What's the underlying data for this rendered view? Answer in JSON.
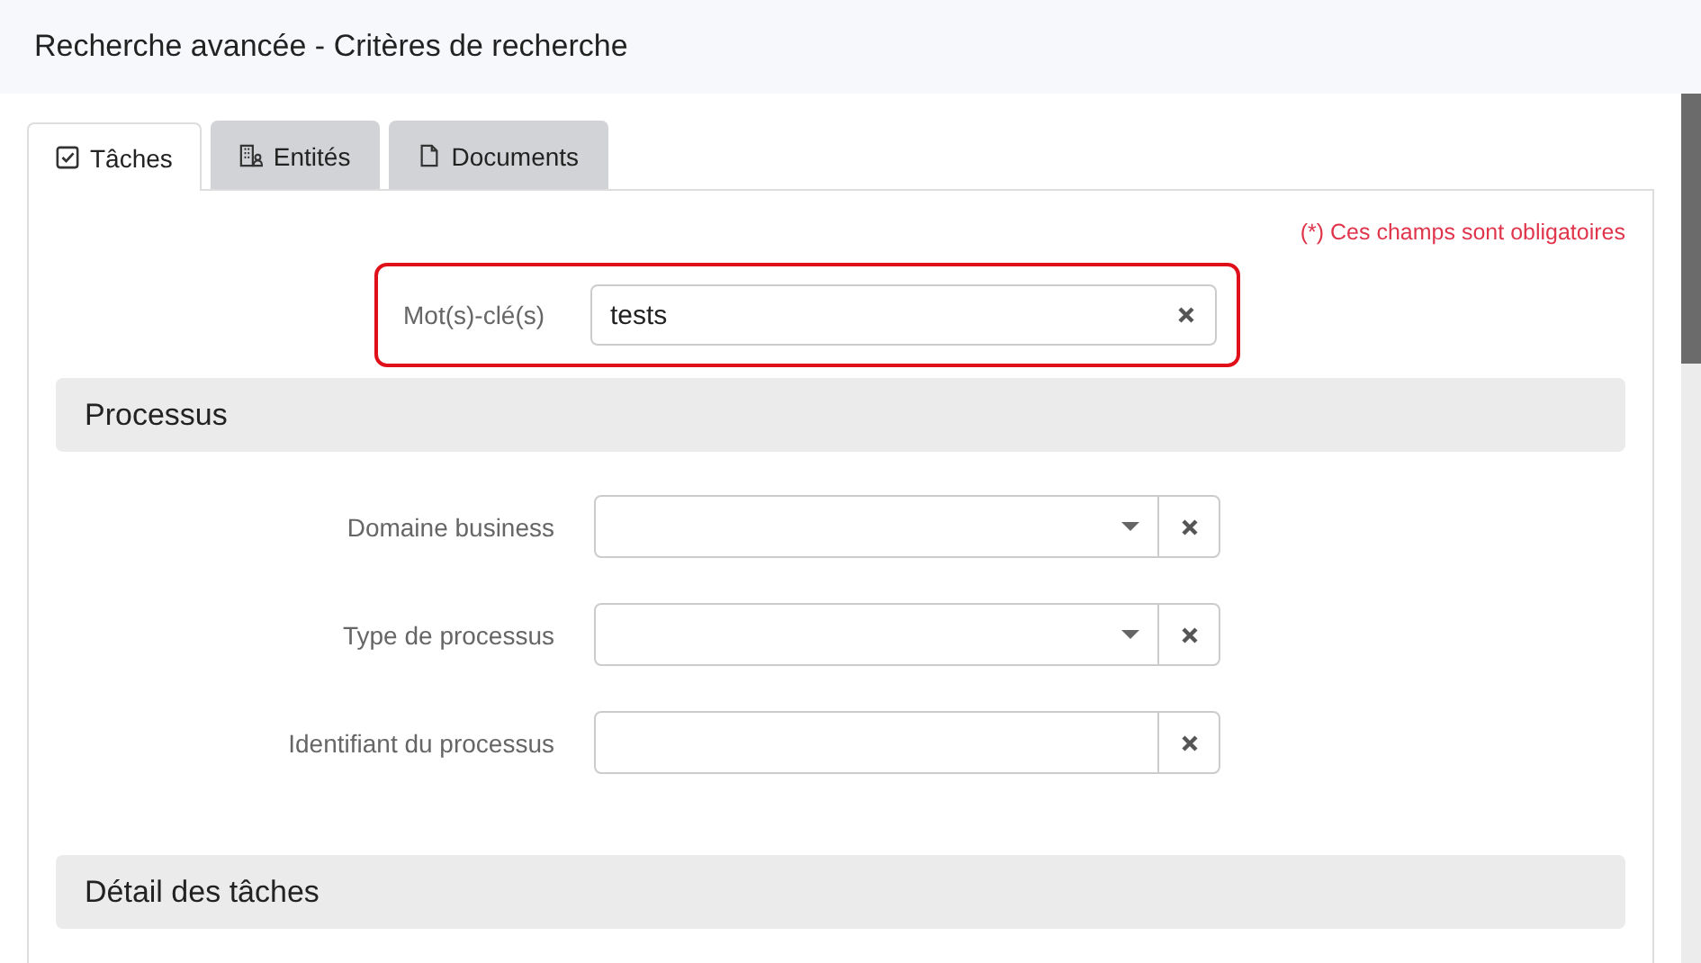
{
  "window": {
    "title": "Recherche avancée - Critères de recherche"
  },
  "tabs": [
    {
      "label": "Tâches",
      "kind": "checkbox",
      "selected": true
    },
    {
      "label": "Entités",
      "kind": "building",
      "selected": false
    },
    {
      "label": "Documents",
      "kind": "document",
      "selected": false
    }
  ],
  "required_note": "(*) Ces champs sont obligatoires",
  "keyword": {
    "label": "Mot(s)-clé(s)",
    "value": "tests",
    "highlighted": true
  },
  "sections": [
    {
      "title": "Processus",
      "fields": [
        {
          "label": "Domaine business",
          "kind": "select"
        },
        {
          "label": "Type de processus",
          "kind": "select"
        },
        {
          "label": "Identifiant du processus",
          "kind": "text"
        }
      ]
    },
    {
      "title": "Détail des tâches"
    }
  ]
}
